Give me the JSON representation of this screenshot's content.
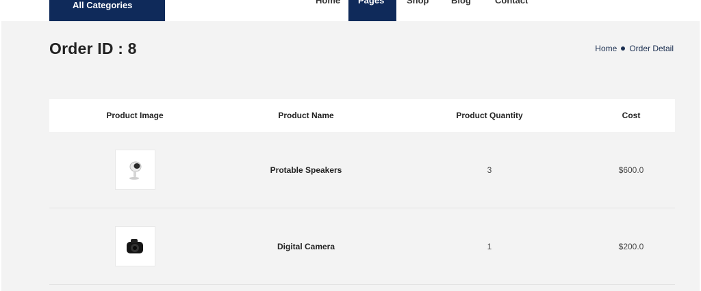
{
  "topnav": {
    "categories_label": "All Categories",
    "items": [
      "Home",
      "Pages",
      "Shop",
      "Blog",
      "Contact"
    ]
  },
  "page": {
    "title": "Order ID : 8"
  },
  "breadcrumb": {
    "home": "Home",
    "current": "Order Detail"
  },
  "table": {
    "headers": [
      "Product Image",
      "Product Name",
      "Product Quantity",
      "Cost"
    ],
    "rows": [
      {
        "image_icon": "speaker-icon",
        "name": "Protable Speakers",
        "quantity": "3",
        "cost": "$600.0"
      },
      {
        "image_icon": "camera-icon",
        "name": "Digital Camera",
        "quantity": "1",
        "cost": "$200.0"
      }
    ]
  },
  "colors": {
    "primary": "#0f2a5a",
    "page_bg": "#f3f3f3",
    "link": "#1a2e50"
  }
}
